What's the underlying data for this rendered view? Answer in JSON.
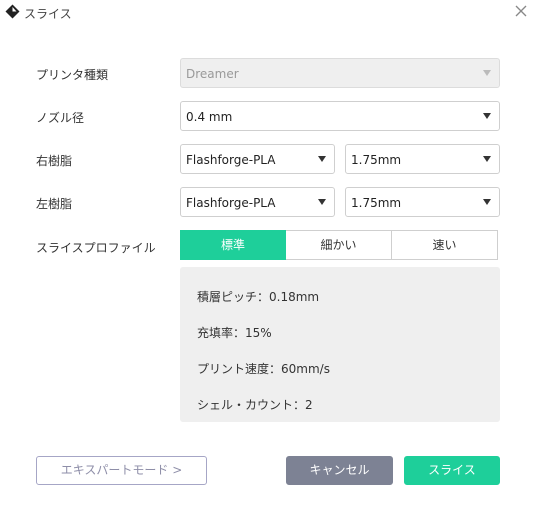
{
  "window": {
    "title": "スライス",
    "icon": "diamond-app-icon",
    "close_icon": "close-icon"
  },
  "form": {
    "printer_type": {
      "label": "プリンタ種類",
      "value": "Dreamer",
      "disabled": true
    },
    "nozzle": {
      "label": "ノズル径",
      "value": "0.4 mm"
    },
    "right_filament": {
      "label": "右樹脂",
      "material": "Flashforge-PLA",
      "diameter": "1.75mm"
    },
    "left_filament": {
      "label": "左樹脂",
      "material": "Flashforge-PLA",
      "diameter": "1.75mm"
    },
    "profile": {
      "label": "スライスプロファイル",
      "options": [
        "標準",
        "細かい",
        "速い"
      ],
      "selected": "標準"
    }
  },
  "profile_details": {
    "layer_pitch": "積層ピッチ：0.18mm",
    "infill": "充填率：15%",
    "print_speed": "プリント速度：60mm/s",
    "shell_count": "シェル・カウント：2"
  },
  "buttons": {
    "expert_mode": "エキスパートモード >",
    "cancel": "キャンセル",
    "slice": "スライス"
  },
  "colors": {
    "accent": "#1ecf9a",
    "cancel_bg": "#7d8294",
    "panel_bg": "#efefef"
  }
}
